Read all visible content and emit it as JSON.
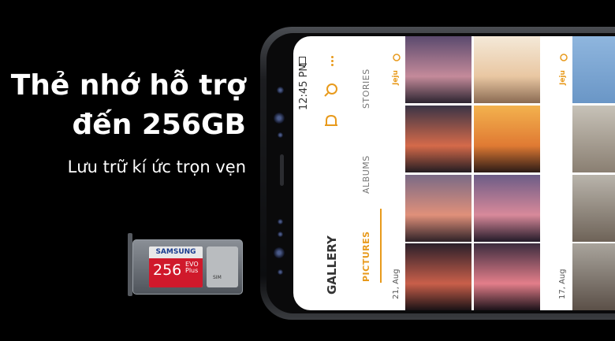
{
  "headline": {
    "line1": "Thẻ nhớ hỗ trợ",
    "line2": "đến 256GB",
    "subline": "Lưu trữ kí ức trọn vẹn"
  },
  "sd_card": {
    "brand": "SAMSUNG",
    "capacity": "256",
    "series_top": "EVO",
    "series_bottom": "Plus",
    "sim_label": "SIM"
  },
  "phone_ui": {
    "time": "12:45 PM",
    "app_title": "GALLERY",
    "tabs": [
      {
        "label": "PICTURES",
        "active": true
      },
      {
        "label": "ALBUMS",
        "active": false
      },
      {
        "label": "STORIES",
        "active": false
      }
    ],
    "dates": [
      "21, Aug",
      "17, Aug"
    ],
    "locations": [
      "Jeju",
      "Jeju"
    ],
    "icons": [
      "search-icon",
      "bell-icon",
      "more-vertical-icon",
      "location-pin-icon"
    ]
  },
  "colors": {
    "accent": "#e89a1c",
    "background": "#000000",
    "sd_red": "#d0192b"
  }
}
